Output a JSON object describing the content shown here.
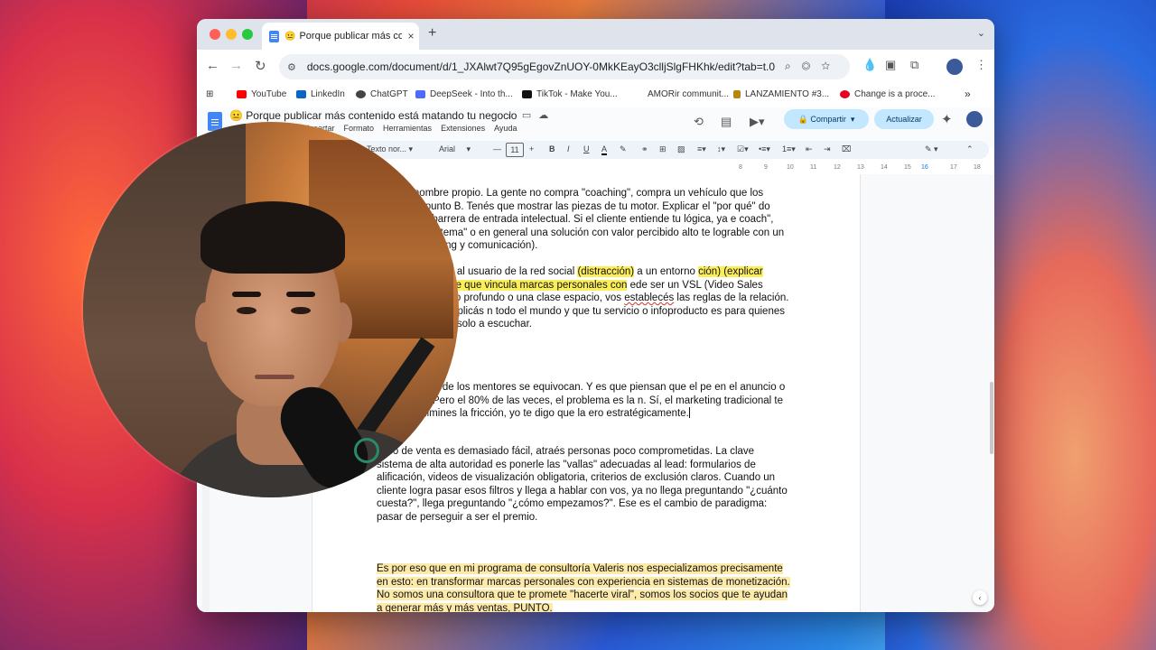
{
  "browser": {
    "tab": {
      "emoji": "😐",
      "title": "Porque publicar más conte",
      "close": "×"
    },
    "new_tab": "+",
    "tab_menu": "⌄",
    "url": "docs.google.com/document/d/1_JXAlwt7Q95gEgovZnUOY-0MkKEayO3clljSlgFHKhk/edit?tab=t.0",
    "bookmarks": [
      {
        "label": "YouTube",
        "color": "#ff0000"
      },
      {
        "label": "LinkedIn",
        "color": "#0a66c2"
      },
      {
        "label": "ChatGPT",
        "color": "#444444"
      },
      {
        "label": "DeepSeek - Into th...",
        "color": "#4d6bfe"
      },
      {
        "label": "TikTok - Make You...",
        "color": "#111111"
      },
      {
        "label": "AMORir communit...",
        "color": "#ffffff"
      },
      {
        "label": "LANZAMIENTO #3...",
        "color": "#b8860b"
      },
      {
        "label": "Change is a proce...",
        "color": "#e60023"
      }
    ],
    "bookmarks_more": "»"
  },
  "docs": {
    "title": "😐 Porque publicar más contenido está matando tu negocio",
    "menus": [
      "Insertar",
      "Formato",
      "Herramientas",
      "Extensiones",
      "Ayuda"
    ],
    "share_label": "Compartir",
    "update_label": "Actualizar",
    "toolbar": {
      "style": "Texto nor...",
      "font": "Arial",
      "size": "11"
    },
    "ruler_numbers": [
      "8",
      "9",
      "10",
      "11",
      "12",
      "13",
      "14",
      "15",
      "16",
      "17",
      "18"
    ]
  },
  "document": {
    "p1": "ma con nombre propio. La gente no compra \"coaching\", compra un vehículo que los punto A al punto B. Tenés que mostrar las piezas de tu motor. Explicar el \"por qué\" do genera una barrera de entrada intelectual. Si el cliente entiende tu lógica, ya e coach\", busca \"TU sistema\" o en general una solución con valor percibido alto te lograble con un poco de branding y comunicación).",
    "p2_a": "nido debe mover al usuario de la red social ",
    "p2_hl1": "(distracción)",
    "p2_b": " a un entorno ",
    "p2_hl2": "ción) (explicar tendencia reciente que vincula marcas personales con",
    "p2_c": " ede ser un VSL (Video Sales Letter), un artículo profundo o una clase espacio, vos ",
    "p2_squig": "establecés",
    "p2_d": " las reglas de la relación. Aquí es donde explicás n todo el mundo y que tu servicio o infoproducto es para quienes están mentar, no solo a escuchar.",
    "p3": "de la mayoría de los mentores se equivocan. Y es que piensan que el pe en el anuncio o en el email. Pero el 80% de las veces, el problema es la n. Sí, el marketing tradicional te dice que elimines la fricción, yo te digo que la ero estratégicamente.",
    "p4": "ceso de venta es demasiado fácil, atraés personas poco comprometidas. La clave sistema de alta autoridad es ponerle las \"vallas\" adecuadas al lead: formularios de alificación, videos de visualización obligatoria, criterios de exclusión claros. Cuando un cliente logra pasar esos filtros y llega a hablar con vos, ya no llega preguntando \"¿cuánto cuesta?\", llega preguntando \"¿cómo empezamos?\". Ese es el cambio de paradigma: pasar de perseguir a ser el premio.",
    "p5": "Es por eso que en mi programa de consultoría Valeris nos especializamos precisamente en esto: en transformar marcas personales con experiencia en sistemas de monetización. No somos una consultora que te promete \"hacerte viral\", somos los socios que te ayudan a generar más y más ventas, PUNTO."
  },
  "colors": {
    "highlight_yellow": "#fcee5a",
    "highlight_orange": "#fde9a8",
    "share_bg": "#c2e7ff"
  }
}
